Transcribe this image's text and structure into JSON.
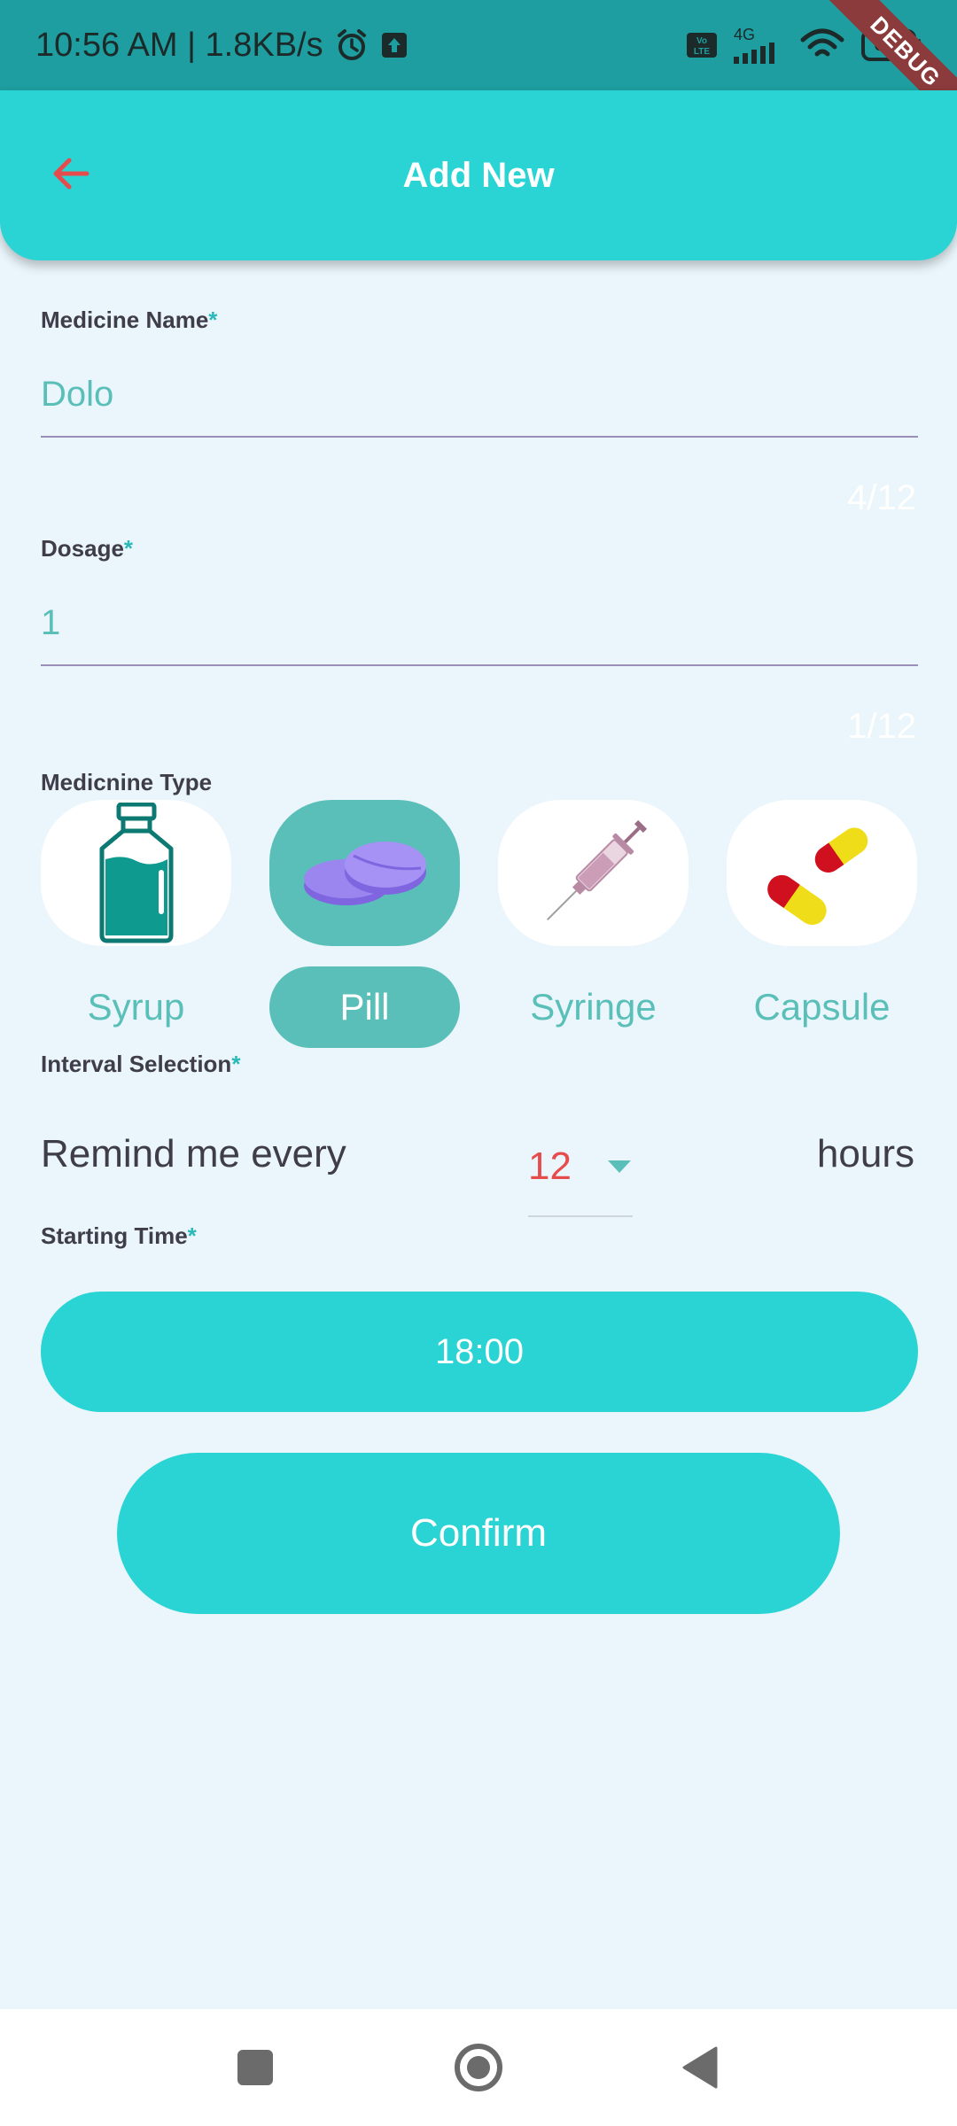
{
  "status_bar": {
    "time": "10:56 AM | 1.8KB/s",
    "network": "4G",
    "battery": "66",
    "debug_label": "DEBUG"
  },
  "app_bar": {
    "title": "Add New",
    "back_icon": "arrow-back-icon"
  },
  "form": {
    "medicine_name": {
      "label": "Medicine Name",
      "required_mark": "*",
      "value": "Dolo",
      "counter": "4/12"
    },
    "dosage": {
      "label": "Dosage",
      "required_mark": "*",
      "value": "1",
      "counter": "1/12"
    },
    "medicine_type": {
      "label": "Medicnine Type",
      "options": [
        {
          "label": "Syrup",
          "icon": "syrup-bottle-icon",
          "selected": false
        },
        {
          "label": "Pill",
          "icon": "pill-icon",
          "selected": true
        },
        {
          "label": "Syringe",
          "icon": "syringe-icon",
          "selected": false
        },
        {
          "label": "Capsule",
          "icon": "capsule-icon",
          "selected": false
        }
      ]
    },
    "interval": {
      "label": "Interval Selection",
      "required_mark": "*",
      "prefix": "Remind me every",
      "value": "12",
      "suffix": "hours"
    },
    "starting_time": {
      "label": "Starting Time",
      "required_mark": "*",
      "value": "18:00"
    },
    "confirm_label": "Confirm"
  },
  "colors": {
    "accent": "#2ad4d4",
    "accent_dark": "#5bbfb9",
    "status_bar": "#1e9ea0",
    "background": "#eaf6fb",
    "dropdown_value": "#e74c4c"
  },
  "nav_bar": {
    "recents_icon": "square-icon",
    "home_icon": "circle-icon",
    "back_icon": "triangle-back-icon"
  }
}
